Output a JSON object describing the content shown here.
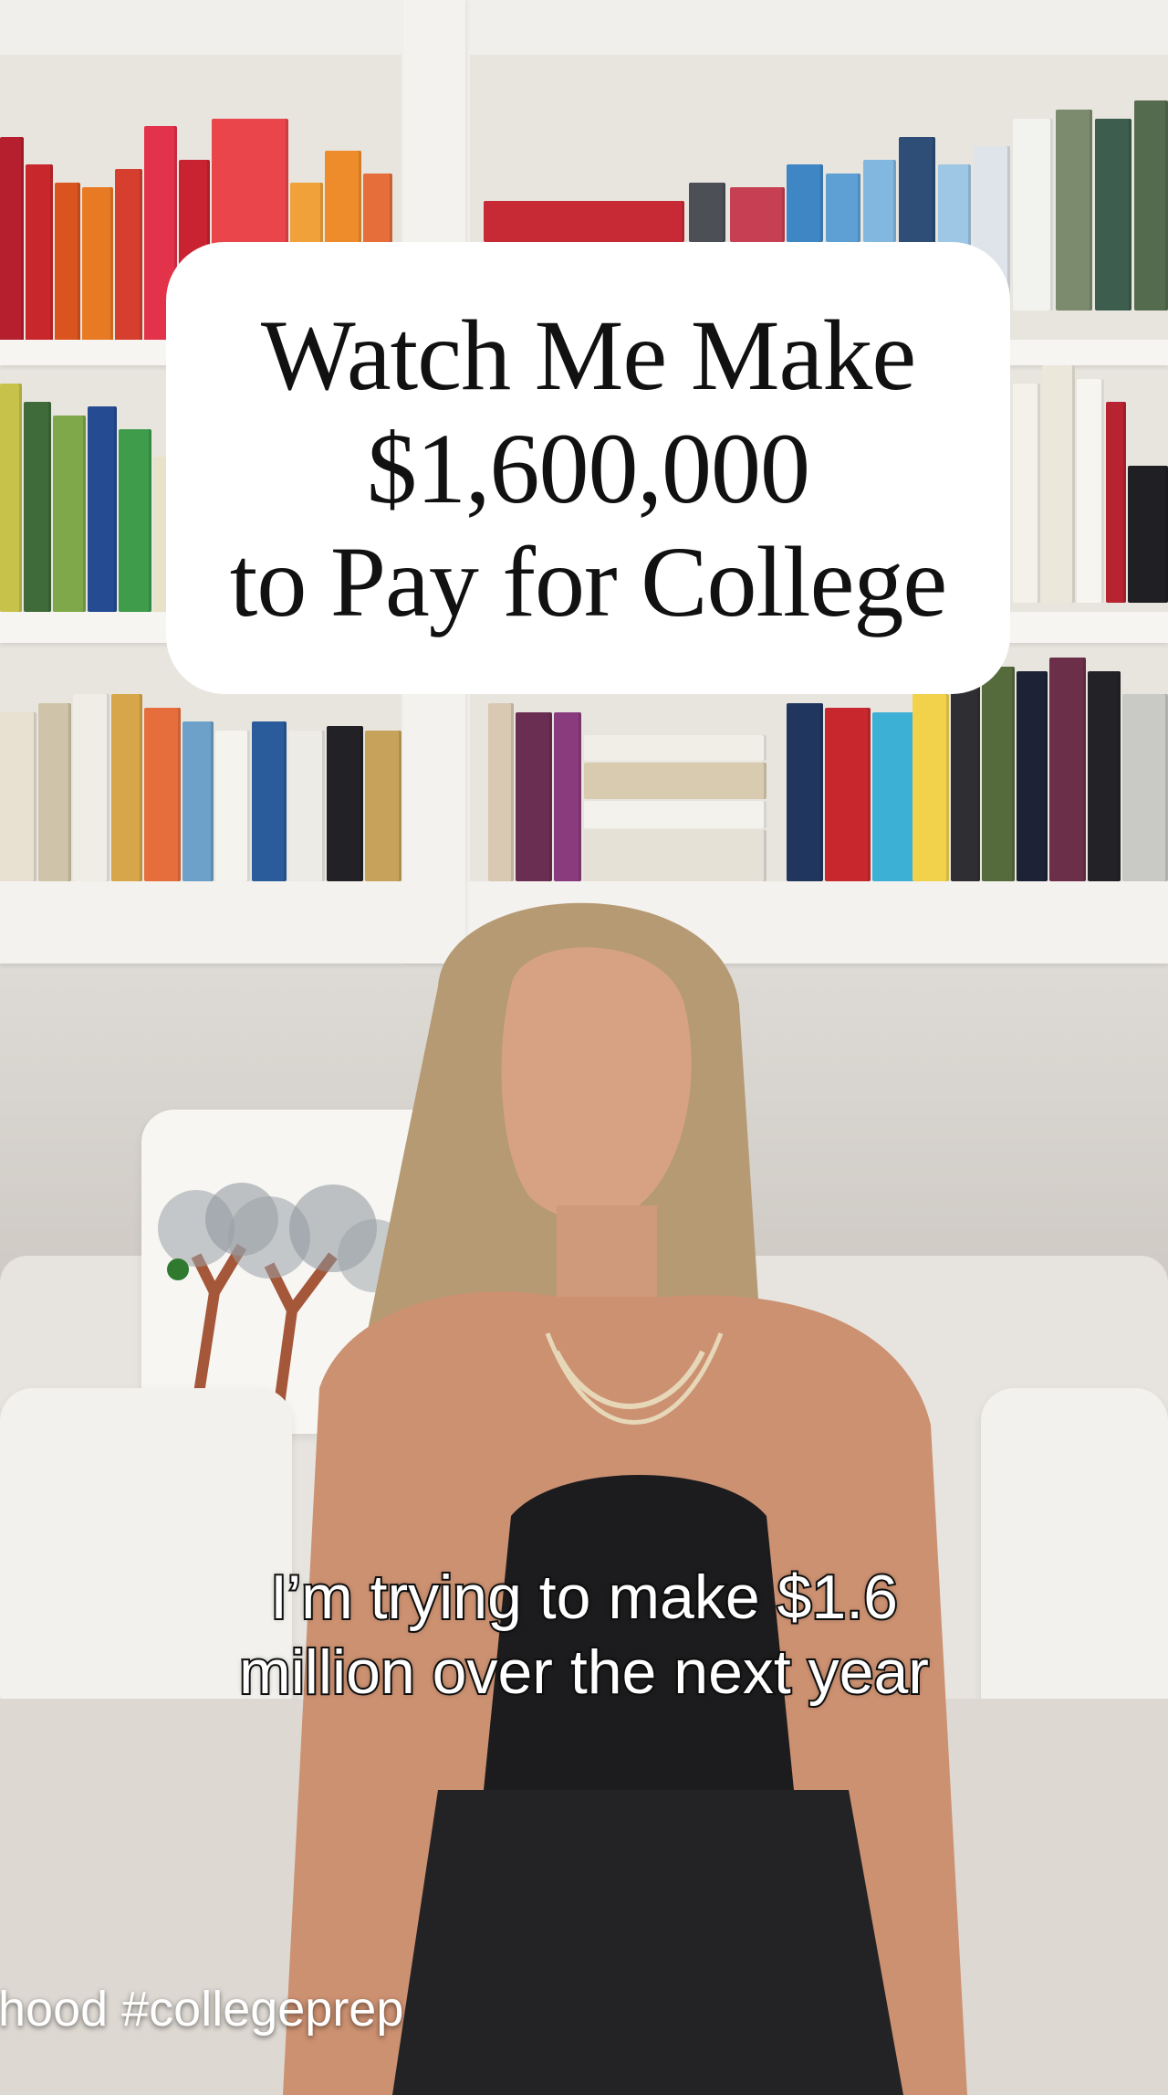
{
  "title_card": {
    "lines": [
      "Watch Me Make",
      "$1,600,000",
      "to Pay for College"
    ]
  },
  "caption": {
    "lines": [
      "I’m trying to make $1.6",
      "million over the next year"
    ]
  },
  "description": {
    "hashtags": "hood #collegeprep"
  },
  "colors": {
    "title_card_bg": "#ffffff",
    "title_text": "#111111",
    "caption_text": "#ffffff"
  }
}
